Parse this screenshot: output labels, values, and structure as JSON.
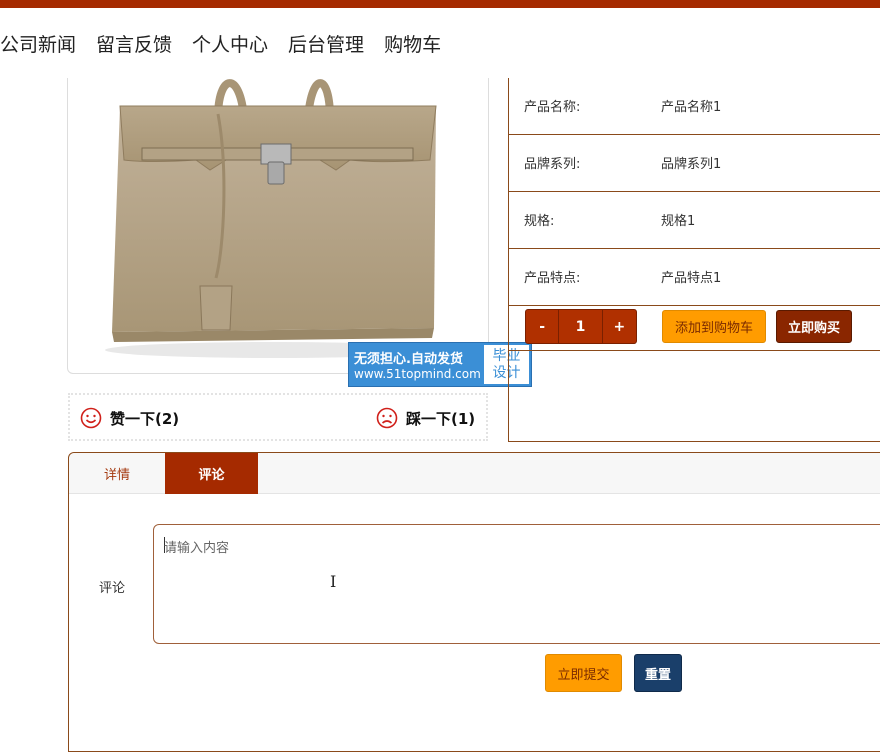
{
  "nav": {
    "items": [
      "公司新闻",
      "留言反馈",
      "个人中心",
      "后台管理",
      "购物车"
    ]
  },
  "product": {
    "image_alt": "handbag-photo",
    "rows": [
      {
        "label": "产品名称:",
        "value": "产品名称1"
      },
      {
        "label": "品牌系列:",
        "value": "品牌系列1"
      },
      {
        "label": "规格:",
        "value": "规格1"
      },
      {
        "label": "产品特点:",
        "value": "产品特点1"
      }
    ],
    "quantity": {
      "minus": "-",
      "value": "1",
      "plus": "+"
    },
    "add_to_cart": "添加到购物车",
    "buy_now": "立即购买"
  },
  "watermark": {
    "line1": "无须担心.自动发货",
    "line2": "www.51topmind.com",
    "badge_line1": "毕业",
    "badge_line2": "设计"
  },
  "votes": {
    "like": "赞一下(2)",
    "dislike": "踩一下(1)"
  },
  "tabs": {
    "detail": "详情",
    "comment": "评论",
    "active": "评论"
  },
  "comment_form": {
    "label": "评论",
    "placeholder": "请输入内容",
    "submit": "立即提交",
    "reset": "重置"
  },
  "colors": {
    "brand": "#a52a00",
    "accent": "#ff9c00",
    "reset": "#1a3f6a",
    "watermark": "#3b8fd6"
  }
}
